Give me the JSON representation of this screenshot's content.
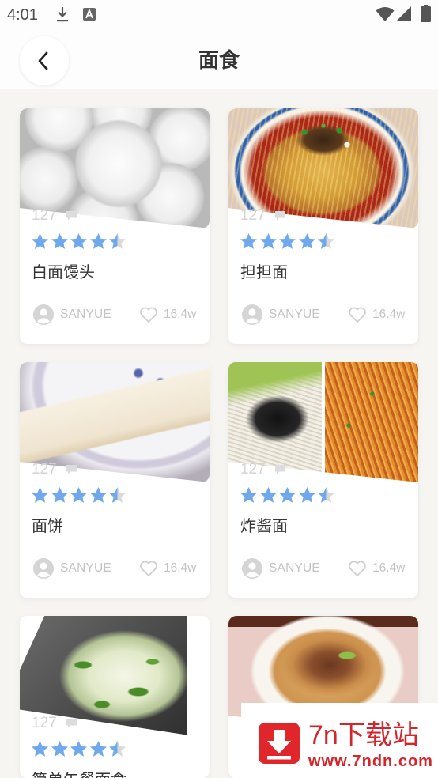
{
  "status_bar": {
    "time": "4:01",
    "left_icons": [
      "download-icon",
      "a-box-icon"
    ],
    "right_icons": [
      "wifi-icon",
      "signal-icon",
      "battery-icon"
    ]
  },
  "header": {
    "title": "面食",
    "back_icon": "chevron-left-icon"
  },
  "recipes": [
    {
      "title": "白面馒头",
      "comments": "127",
      "rating": 4.5,
      "author": "SANYUE",
      "likes": "16.4w"
    },
    {
      "title": "担担面",
      "comments": "127",
      "rating": 4.5,
      "author": "SANYUE",
      "likes": "16.4w"
    },
    {
      "title": "面饼",
      "comments": "127",
      "rating": 4.5,
      "author": "SANYUE",
      "likes": "16.4w"
    },
    {
      "title": "炸酱面",
      "comments": "127",
      "rating": 4.5,
      "author": "SANYUE",
      "likes": "16.4w"
    },
    {
      "title": "简单午餐面食",
      "comments": "127",
      "rating": 4.5
    }
  ],
  "card_icons": {
    "comment": "comment-icon",
    "author": "avatar-icon",
    "like": "heart-icon"
  },
  "colors": {
    "star": "#6fa8ec",
    "star_empty": "#d9d9d9",
    "page_background": "#f6f5f2",
    "watermark_red": "#d5242a"
  },
  "watermark": {
    "name": "7n下载站",
    "url": "www.7ndn.com"
  }
}
